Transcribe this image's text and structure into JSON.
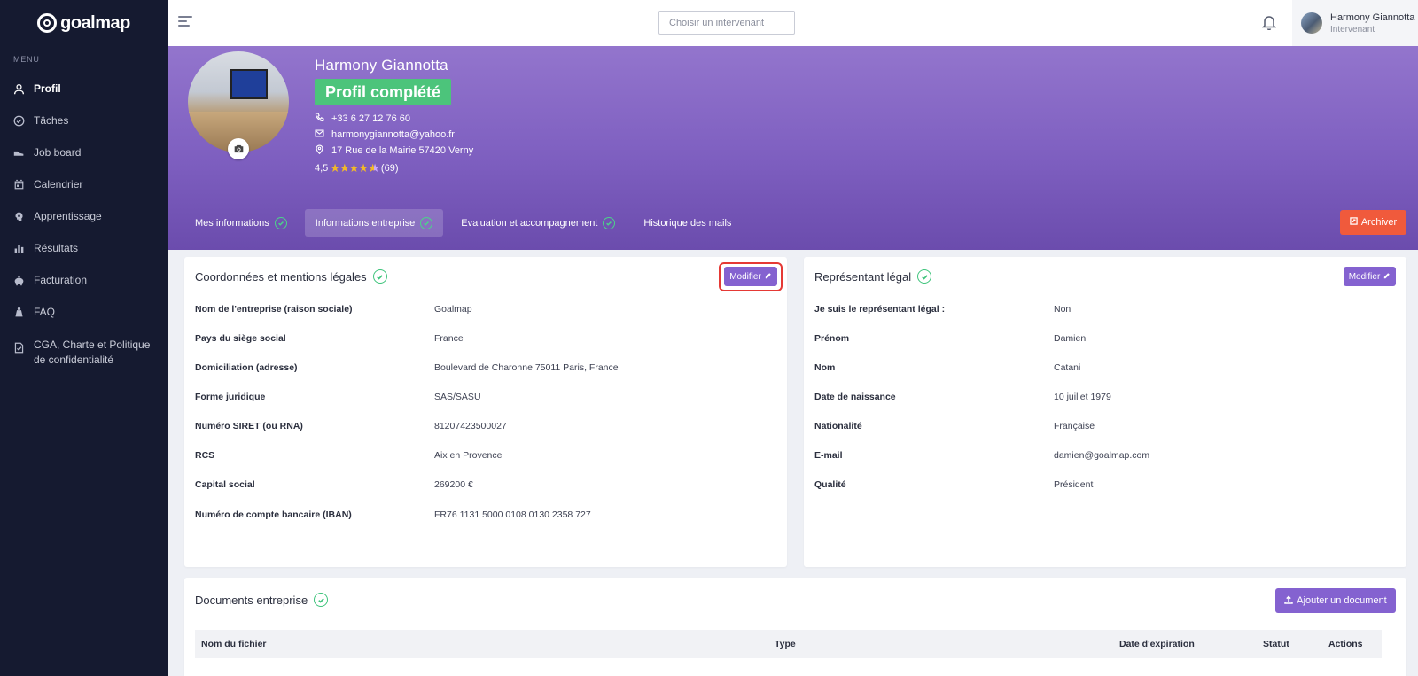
{
  "app": {
    "logo_text": "goalmap"
  },
  "sidebar": {
    "menu_heading": "MENU",
    "items": [
      {
        "label": "Profil",
        "icon": "user-icon",
        "active": true
      },
      {
        "label": "Tâches",
        "icon": "check-circle-icon",
        "active": false
      },
      {
        "label": "Job board",
        "icon": "shoe-icon",
        "active": false
      },
      {
        "label": "Calendrier",
        "icon": "calendar-icon",
        "active": false
      },
      {
        "label": "Apprentissage",
        "icon": "brain-icon",
        "active": false
      },
      {
        "label": "Résultats",
        "icon": "bar-chart-icon",
        "active": false
      },
      {
        "label": "Facturation",
        "icon": "piggy-bank-icon",
        "active": false
      },
      {
        "label": "FAQ",
        "icon": "faq-icon",
        "active": false
      },
      {
        "label": "CGA, Charte et Politique de confidentialité",
        "icon": "document-icon",
        "active": false
      }
    ]
  },
  "topbar": {
    "search_placeholder": "Choisir un intervenant",
    "user_name": "Harmony Giannotta",
    "user_role": "Intervenant"
  },
  "profile": {
    "name": "Harmony Giannotta",
    "status_badge": "Profil complété",
    "phone": "+33 6 27 12 76 60",
    "email": "harmonygiannotta@yahoo.fr",
    "address": "17 Rue de la Mairie 57420 Verny",
    "rating_value": "4,5",
    "rating_count": "(69)",
    "stars": 4.5
  },
  "tabs": [
    {
      "label": "Mes informations",
      "checked": true
    },
    {
      "label": "Informations entreprise",
      "checked": true,
      "active": true
    },
    {
      "label": "Evaluation et accompagnement",
      "checked": true
    },
    {
      "label": "Historique des mails",
      "checked": false
    }
  ],
  "archive_label": "Archiver",
  "company_card": {
    "title": "Coordonnées et mentions légales",
    "edit_label": "Modifier",
    "rows": [
      {
        "label": "Nom de l'entreprise (raison sociale)",
        "value": "Goalmap"
      },
      {
        "label": "Pays du siège social",
        "value": "France"
      },
      {
        "label": "Domiciliation (adresse)",
        "value": "Boulevard de Charonne 75011 Paris, France"
      },
      {
        "label": "Forme juridique",
        "value": "SAS/SASU"
      },
      {
        "label": "Numéro SIRET (ou RNA)",
        "value": "81207423500027"
      },
      {
        "label": "RCS",
        "value": "Aix en Provence"
      },
      {
        "label": "Capital social",
        "value": "269200 €"
      },
      {
        "label": "Numéro de compte bancaire (IBAN)",
        "value": "FR76 1131 5000 0108 0130 2358 727"
      }
    ]
  },
  "legal_card": {
    "title": "Représentant légal",
    "edit_label": "Modifier",
    "rows": [
      {
        "label": "Je suis le représentant légal :",
        "value": "Non"
      },
      {
        "label": "Prénom",
        "value": "Damien"
      },
      {
        "label": "Nom",
        "value": "Catani"
      },
      {
        "label": "Date de naissance",
        "value": "10 juillet 1979"
      },
      {
        "label": "Nationalité",
        "value": "Française"
      },
      {
        "label": "E-mail",
        "value": "damien@goalmap.com"
      },
      {
        "label": "Qualité",
        "value": "Président"
      }
    ]
  },
  "documents_card": {
    "title": "Documents entreprise",
    "add_label": "Ajouter un document",
    "columns": [
      "Nom du fichier",
      "Type",
      "Date d'expiration",
      "Statut",
      "Actions"
    ]
  },
  "colors": {
    "sidebar": "#151a30",
    "accent": "#8462d0",
    "success": "#4cc47b",
    "danger": "#f05a3c"
  }
}
